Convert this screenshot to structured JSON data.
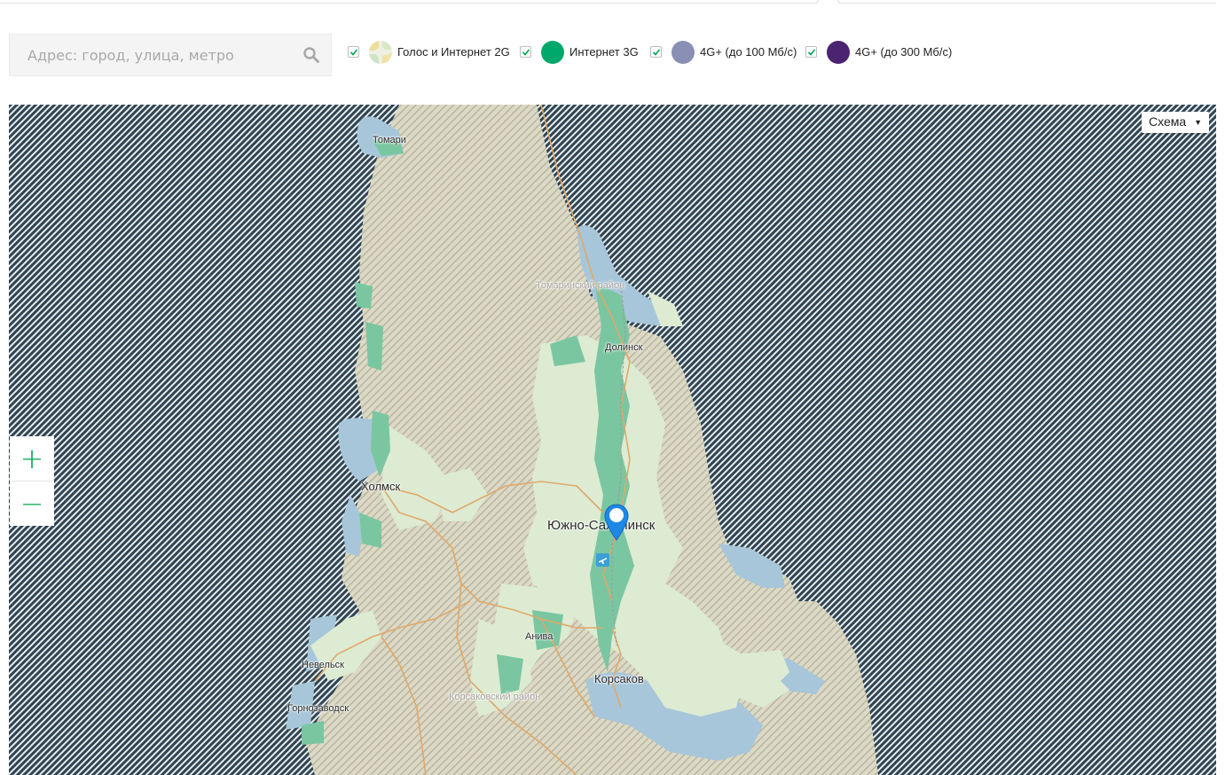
{
  "search": {
    "placeholder": "Адрес: город, улица, метро"
  },
  "legend": [
    {
      "label": "Голос и Интернет 2G",
      "checked": true,
      "swatch": "2g-pattern"
    },
    {
      "label": "Интернет 3G",
      "checked": true,
      "color": "#00a86b"
    },
    {
      "label": "4G+ (до 100 Мб/с)",
      "checked": true,
      "color": "#8a8fb5"
    },
    {
      "label": "4G+ (до 300 Мб/с)",
      "checked": true,
      "color": "#4a2470"
    }
  ],
  "map": {
    "layer_button": "Схема",
    "zoom_in": "+",
    "zoom_out": "−",
    "labels": {
      "tomari": "Томари",
      "tomarinsky": "Томаринский район",
      "dolinsk": "Долинск",
      "kholmsk": "Холмск",
      "yuzhno": "Южно-Сахалинск",
      "aniva": "Анива",
      "korsakov": "Корсаков",
      "nevelsk": "Невельск",
      "gornozavodsk": "Горнозаводск",
      "korsakovsky": "Корсаковский район"
    }
  },
  "colors": {
    "accent": "#00a651",
    "coverage_3g": "#00a86b",
    "coverage_4g_100": "#8a8fb5",
    "coverage_4g_300": "#4a2470",
    "no_coverage_hatch": "#2f4452",
    "pin": "#1e88e5"
  }
}
